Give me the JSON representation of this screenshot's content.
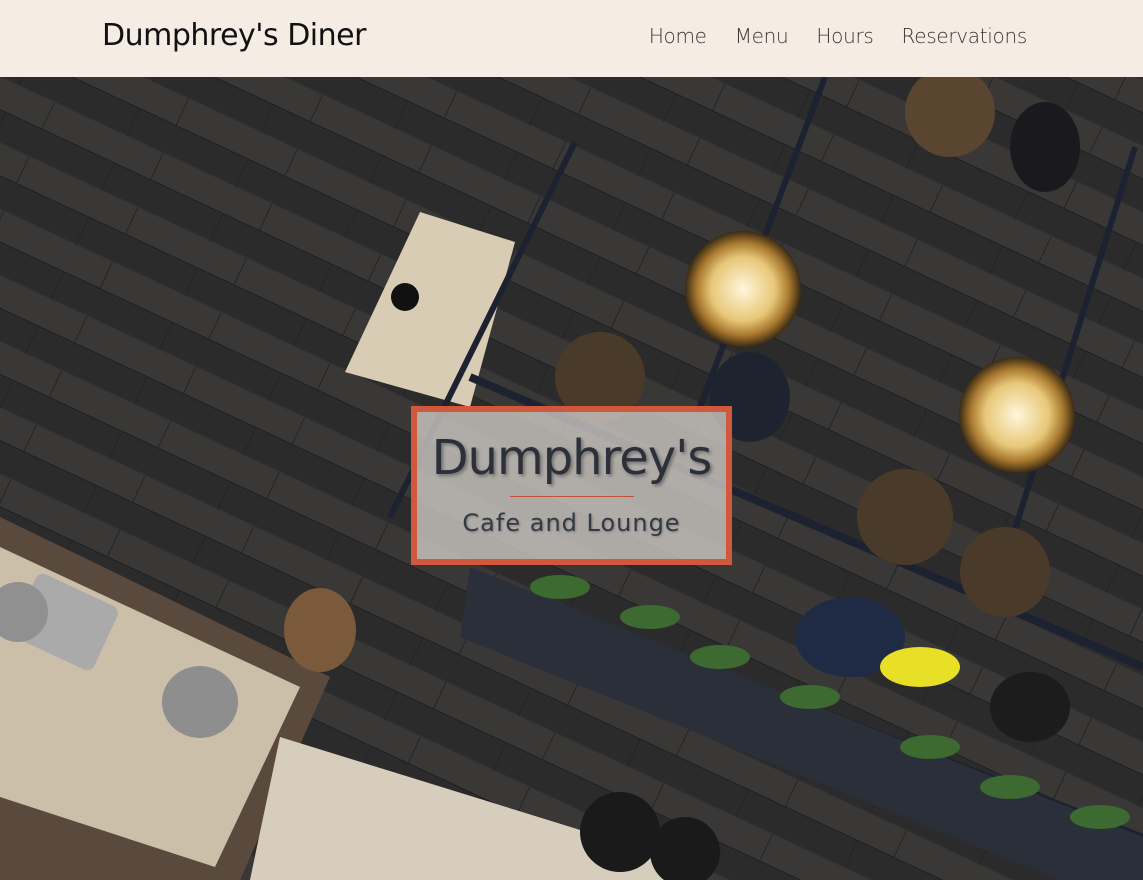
{
  "navbar": {
    "brand": "Dumphrey's Diner",
    "links": [
      {
        "label": "Home"
      },
      {
        "label": "Menu"
      },
      {
        "label": "Hours"
      },
      {
        "label": "Reservations"
      }
    ]
  },
  "hero": {
    "title": "Dumphrey's",
    "subtitle": "Cafe and Lounge"
  },
  "colors": {
    "navbar_bg": "#f5ede3",
    "accent_border": "#d1583a",
    "title_text": "#2c3038"
  }
}
